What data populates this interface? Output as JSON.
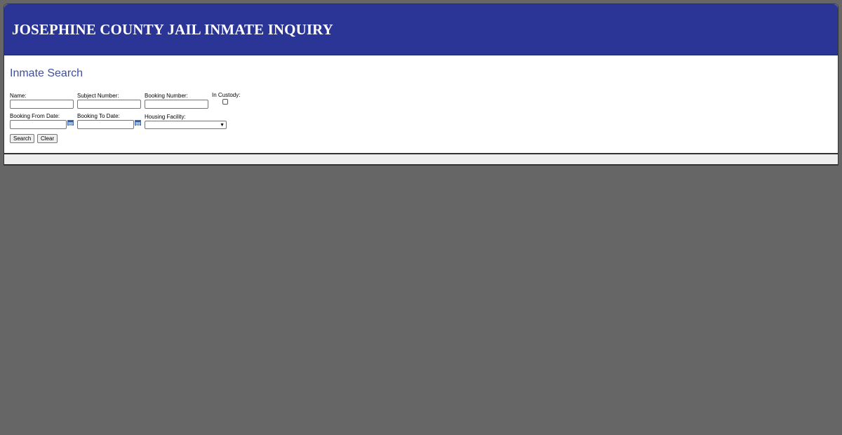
{
  "header": {
    "title": "JOSEPHINE COUNTY JAIL INMATE INQUIRY"
  },
  "search": {
    "section_title": "Inmate Search",
    "fields": {
      "name": {
        "label": "Name:",
        "value": ""
      },
      "subject_number": {
        "label": "Subject Number:",
        "value": ""
      },
      "booking_number": {
        "label": "Booking Number:",
        "value": ""
      },
      "in_custody": {
        "label": "In Custody:",
        "checked": false
      },
      "booking_from_date": {
        "label": "Booking From Date:",
        "value": ""
      },
      "booking_to_date": {
        "label": "Booking To Date:",
        "value": ""
      },
      "housing_facility": {
        "label": "Housing Facility:",
        "selected": ""
      }
    },
    "buttons": {
      "search": "Search",
      "clear": "Clear"
    }
  },
  "colors": {
    "header_bg": "#2a3596",
    "section_title": "#3f4f9e",
    "page_bg": "#666666"
  },
  "icons": {
    "calendar": "calendar-icon",
    "dropdown": "chevron-down-icon"
  }
}
